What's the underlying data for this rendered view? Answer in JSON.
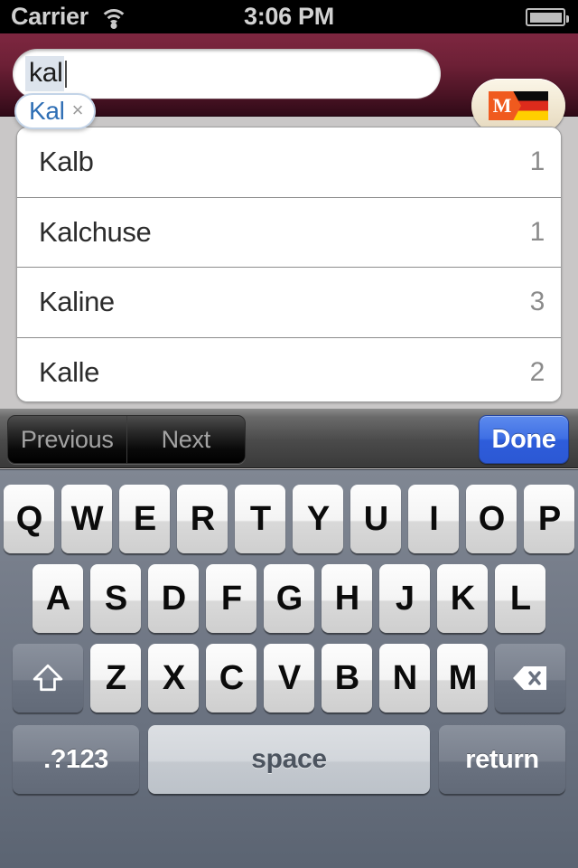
{
  "status_bar": {
    "carrier": "Carrier",
    "wifi_icon": "wifi-icon",
    "time": "3:06 PM",
    "battery_icon": "battery-icon"
  },
  "nav_bar": {
    "search": {
      "value": "kal",
      "marked_text": true
    },
    "suggestion": {
      "word": "Kal",
      "dismiss_label": "×"
    },
    "language_button": {
      "name": "german-dictionary-button",
      "monogram": "M",
      "flag": "german-flag",
      "flag_colors": [
        "#0a0a0a",
        "#dd2b1c",
        "#ffce00"
      ],
      "monogram_color": "#f05a1e"
    },
    "bar_color": "#6d2036"
  },
  "results": {
    "rows": [
      {
        "word": "Kalb",
        "count": "1"
      },
      {
        "word": "Kalchuse",
        "count": "1"
      },
      {
        "word": "Kaline",
        "count": "3"
      },
      {
        "word": "Kalle",
        "count": "2"
      }
    ]
  },
  "accessory_toolbar": {
    "previous_label": "Previous",
    "next_label": "Next",
    "done_label": "Done",
    "done_color": "#3f6fe4"
  },
  "keyboard": {
    "row1": [
      "Q",
      "W",
      "E",
      "R",
      "T",
      "Y",
      "U",
      "I",
      "O",
      "P"
    ],
    "row2": [
      "A",
      "S",
      "D",
      "F",
      "G",
      "H",
      "J",
      "K",
      "L"
    ],
    "row3": [
      "Z",
      "X",
      "C",
      "V",
      "B",
      "N",
      "M"
    ],
    "shift_icon": "shift-icon",
    "backspace_icon": "backspace-icon",
    "numbers_label": ".?123",
    "space_label": "space",
    "return_label": "return"
  }
}
